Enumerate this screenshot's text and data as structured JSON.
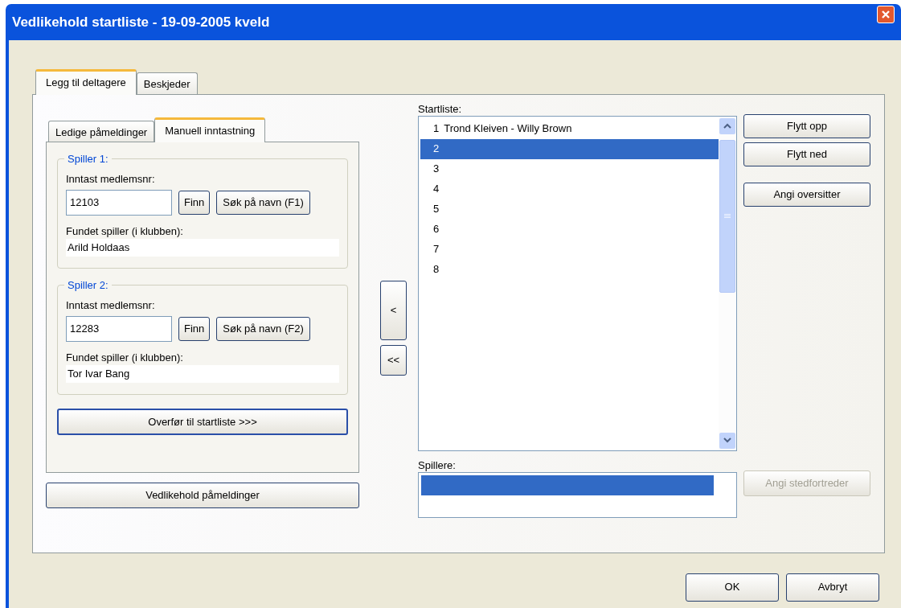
{
  "window": {
    "title": "Vedlikehold startliste - 19-09-2005 kveld"
  },
  "outer_tabs": [
    {
      "label": "Legg til deltagere",
      "selected": true
    },
    {
      "label": "Beskjeder",
      "selected": false
    }
  ],
  "inner_tabs": [
    {
      "label": "Ledige påmeldinger",
      "selected": false
    },
    {
      "label": "Manuell inntastning",
      "selected": true
    }
  ],
  "players": [
    {
      "legend": "Spiller 1:",
      "prompt": "Inntast medlemsnr:",
      "value": "12103",
      "find_button": "Finn",
      "search_button": "Søk på navn (F1)",
      "found_label": "Fundet spiller (i klubben):",
      "found_value": "Arild Holdaas"
    },
    {
      "legend": "Spiller 2:",
      "prompt": "Inntast medlemsnr:",
      "value": "12283",
      "find_button": "Finn",
      "search_button": "Søk på navn (F2)",
      "found_label": "Fundet spiller (i klubben):",
      "found_value": "Tor Ivar Bang"
    }
  ],
  "transfer_button": "Overfør til startliste >>>",
  "maintain_button": "Vedlikehold påmeldinger",
  "move_buttons": [
    "<",
    "<<"
  ],
  "startlist": {
    "label": "Startliste:",
    "rows": [
      {
        "number": "1",
        "name": "Trond Kleiven - Willy Brown",
        "selected": false
      },
      {
        "number": "2",
        "selected": true
      },
      {
        "number": "3",
        "selected": false
      },
      {
        "number": "4",
        "selected": false
      },
      {
        "number": "5",
        "selected": false
      },
      {
        "number": "6",
        "selected": false
      },
      {
        "number": "7",
        "selected": false
      },
      {
        "number": "8",
        "selected": false
      }
    ]
  },
  "side_buttons": [
    {
      "label": "Flytt opp",
      "disabled": false
    },
    {
      "label": "Flytt ned",
      "disabled": false
    },
    {
      "label": "Angi oversitter",
      "disabled": false
    }
  ],
  "players_list": {
    "label": "Spillere:",
    "rows": [
      {
        "selected": true
      }
    ]
  },
  "substitute_button": {
    "label": "Angi stedfortreder",
    "disabled": true
  },
  "ok_button": "OK",
  "cancel_button": "Avbryt"
}
